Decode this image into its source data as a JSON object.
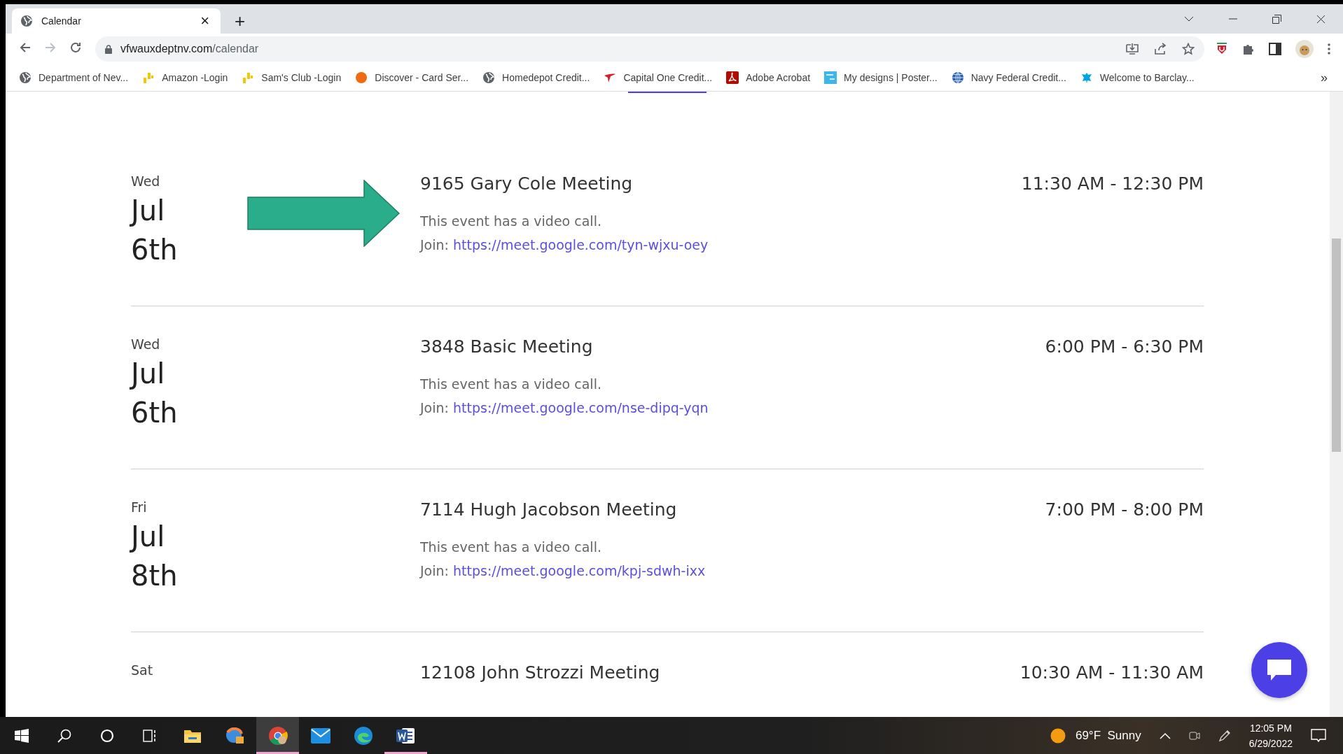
{
  "browser": {
    "tab": {
      "title": "Calendar",
      "close": "×",
      "new_tab": "+"
    },
    "url": {
      "host": "vfwauxdeptnv.com",
      "path": "/calendar"
    },
    "bookmarks": [
      {
        "label": "Department of Nev...",
        "kind": "globe"
      },
      {
        "label": "Amazon -Login",
        "kind": "bars"
      },
      {
        "label": "Sam's Club -Login",
        "kind": "bars"
      },
      {
        "label": "Discover - Card Ser...",
        "kind": "orb"
      },
      {
        "label": "Homedepot Credit...",
        "kind": "globe"
      },
      {
        "label": "Capital One Credit...",
        "kind": "swoosh"
      },
      {
        "label": "Adobe Acrobat",
        "kind": "pdf"
      },
      {
        "label": "My designs | Poster...",
        "kind": "poster"
      },
      {
        "label": "Navy Federal Credit...",
        "kind": "web"
      },
      {
        "label": "Welcome to Barclay...",
        "kind": "eagle"
      }
    ],
    "overflow": "»"
  },
  "events": [
    {
      "weekday": "Wed",
      "month": "Jul",
      "day": "6th",
      "title": "9165 Gary Cole Meeting",
      "time": "11:30 AM - 12:30 PM",
      "note": "This event has a video call.",
      "join_label": "Join:",
      "link": "https://meet.google.com/tyn-wjxu-oey",
      "arrow": true
    },
    {
      "weekday": "Wed",
      "month": "Jul",
      "day": "6th",
      "title": "3848 Basic Meeting",
      "time": "6:00 PM - 6:30 PM",
      "note": "This event has a video call.",
      "join_label": "Join:",
      "link": "https://meet.google.com/nse-dipq-yqn",
      "arrow": false
    },
    {
      "weekday": "Fri",
      "month": "Jul",
      "day": "8th",
      "title": "7114 Hugh Jacobson Meeting",
      "time": "7:00 PM - 8:00 PM",
      "note": "This event has a video call.",
      "join_label": "Join:",
      "link": "https://meet.google.com/kpj-sdwh-ixx",
      "arrow": false
    },
    {
      "weekday": "Sat",
      "title": "12108 John Strozzi Meeting",
      "time": "10:30 AM - 11:30 AM",
      "arrow": false
    }
  ],
  "taskbar": {
    "apps": [
      {
        "kind": "folder",
        "running": false,
        "selected": false
      },
      {
        "kind": "browser-box",
        "running": false,
        "selected": false
      },
      {
        "kind": "chrome",
        "running": true,
        "selected": true
      },
      {
        "kind": "mail",
        "running": false,
        "selected": false
      },
      {
        "kind": "edge",
        "running": false,
        "selected": false
      },
      {
        "kind": "word",
        "running": true,
        "selected": false
      }
    ],
    "weather": "69°F  Sunny",
    "time": "12:05 PM",
    "date": "6/29/2022"
  }
}
